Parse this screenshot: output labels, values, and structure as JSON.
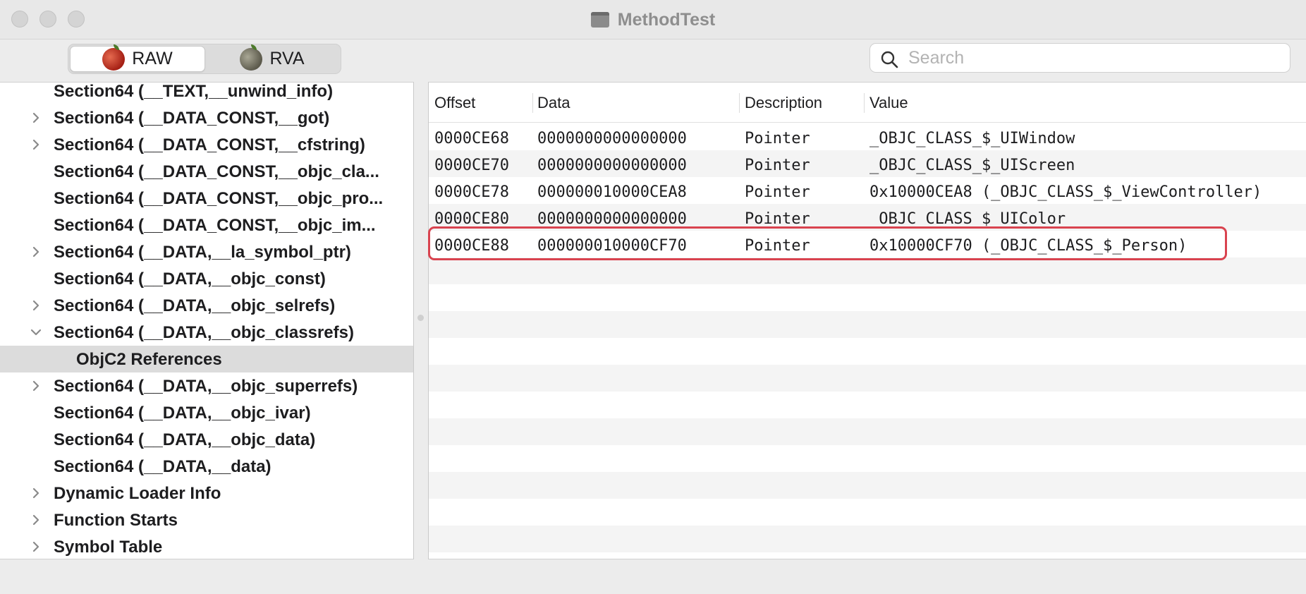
{
  "window": {
    "title": "MethodTest"
  },
  "toolbar": {
    "segments": [
      {
        "label": "RAW",
        "active": true
      },
      {
        "label": "RVA",
        "active": false
      }
    ],
    "search": {
      "placeholder": "Search",
      "value": ""
    }
  },
  "sidebar": {
    "items": [
      {
        "label": "Section64 (__TEXT,__unwind_info)",
        "expandable": false,
        "expanded": false,
        "level": 0,
        "selected": false
      },
      {
        "label": "Section64 (__DATA_CONST,__got)",
        "expandable": true,
        "expanded": false,
        "level": 0,
        "selected": false
      },
      {
        "label": "Section64 (__DATA_CONST,__cfstring)",
        "expandable": true,
        "expanded": false,
        "level": 0,
        "selected": false
      },
      {
        "label": "Section64 (__DATA_CONST,__objc_cla...",
        "expandable": false,
        "expanded": false,
        "level": 0,
        "selected": false
      },
      {
        "label": "Section64 (__DATA_CONST,__objc_pro...",
        "expandable": false,
        "expanded": false,
        "level": 0,
        "selected": false
      },
      {
        "label": "Section64 (__DATA_CONST,__objc_im...",
        "expandable": false,
        "expanded": false,
        "level": 0,
        "selected": false
      },
      {
        "label": "Section64 (__DATA,__la_symbol_ptr)",
        "expandable": true,
        "expanded": false,
        "level": 0,
        "selected": false
      },
      {
        "label": "Section64 (__DATA,__objc_const)",
        "expandable": false,
        "expanded": false,
        "level": 0,
        "selected": false
      },
      {
        "label": "Section64 (__DATA,__objc_selrefs)",
        "expandable": true,
        "expanded": false,
        "level": 0,
        "selected": false
      },
      {
        "label": "Section64 (__DATA,__objc_classrefs)",
        "expandable": true,
        "expanded": true,
        "level": 0,
        "selected": false
      },
      {
        "label": "ObjC2 References",
        "expandable": false,
        "expanded": false,
        "level": 1,
        "selected": true
      },
      {
        "label": "Section64 (__DATA,__objc_superrefs)",
        "expandable": true,
        "expanded": false,
        "level": 0,
        "selected": false
      },
      {
        "label": "Section64 (__DATA,__objc_ivar)",
        "expandable": false,
        "expanded": false,
        "level": 0,
        "selected": false
      },
      {
        "label": "Section64 (__DATA,__objc_data)",
        "expandable": false,
        "expanded": false,
        "level": 0,
        "selected": false
      },
      {
        "label": "Section64 (__DATA,__data)",
        "expandable": false,
        "expanded": false,
        "level": 0,
        "selected": false
      },
      {
        "label": "Dynamic Loader Info",
        "expandable": true,
        "expanded": false,
        "level": 0,
        "selected": false
      },
      {
        "label": "Function Starts",
        "expandable": true,
        "expanded": false,
        "level": 0,
        "selected": false
      },
      {
        "label": "Symbol Table",
        "expandable": true,
        "expanded": false,
        "level": 0,
        "selected": false
      }
    ]
  },
  "table": {
    "columns": [
      "Offset",
      "Data",
      "Description",
      "Value"
    ],
    "rows": [
      {
        "offset": "0000CE68",
        "data": "0000000000000000",
        "description": "Pointer",
        "value": "_OBJC_CLASS_$_UIWindow",
        "highlighted": false
      },
      {
        "offset": "0000CE70",
        "data": "0000000000000000",
        "description": "Pointer",
        "value": "_OBJC_CLASS_$_UIScreen",
        "highlighted": false
      },
      {
        "offset": "0000CE78",
        "data": "000000010000CEA8",
        "description": "Pointer",
        "value": "0x10000CEA8 (_OBJC_CLASS_$_ViewController)",
        "highlighted": false
      },
      {
        "offset": "0000CE80",
        "data": "0000000000000000",
        "description": "Pointer",
        "value": "_OBJC_CLASS_$_UIColor",
        "highlighted": false
      },
      {
        "offset": "0000CE88",
        "data": "000000010000CF70",
        "description": "Pointer",
        "value": "0x10000CF70 (_OBJC_CLASS_$_Person)",
        "highlighted": true
      }
    ],
    "highlight_color": "#d9434f"
  },
  "icons": {
    "raw_segment": "red-apple-icon",
    "rva_segment": "grey-apple-icon",
    "search": "search-icon",
    "title": "document-icon",
    "disclosure_collapsed": "chevron-right-icon",
    "disclosure_expanded": "chevron-down-icon"
  }
}
